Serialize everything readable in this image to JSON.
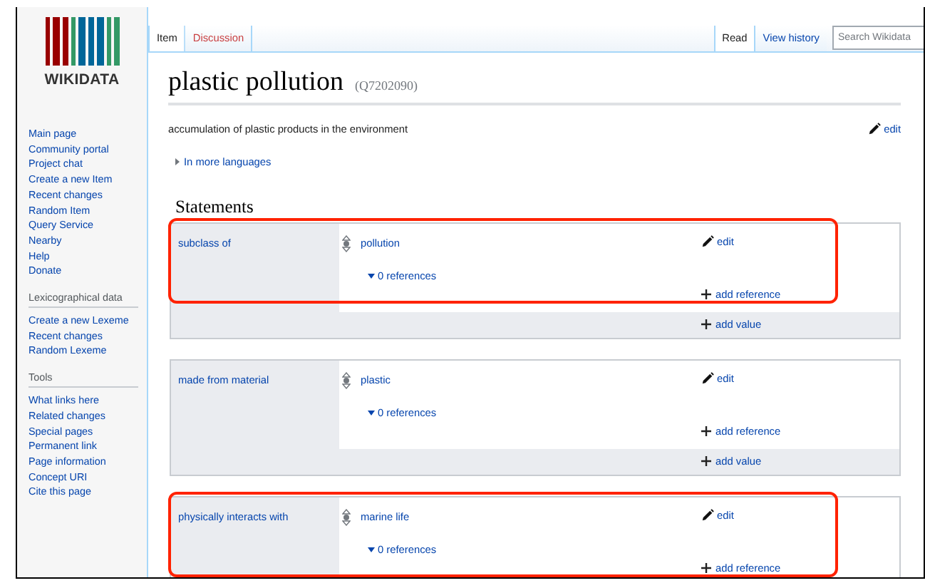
{
  "logo": {
    "wordmark": "WIKIDATA"
  },
  "sidebar": {
    "nav": [
      "Main page",
      "Community portal",
      "Project chat",
      "Create a new Item",
      "Recent changes",
      "Random Item",
      "Query Service",
      "Nearby",
      "Help",
      "Donate"
    ],
    "sections": [
      {
        "heading": "Lexicographical data",
        "items": [
          "Create a new Lexeme",
          "Recent changes",
          "Random Lexeme"
        ]
      },
      {
        "heading": "Tools",
        "items": [
          "What links here",
          "Related changes",
          "Special pages",
          "Permanent link",
          "Page information",
          "Concept URI",
          "Cite this page"
        ]
      }
    ]
  },
  "tabs_left": [
    {
      "label": "Item",
      "selected": true,
      "exists": true
    },
    {
      "label": "Discussion",
      "selected": false,
      "exists": false
    }
  ],
  "tabs_right": [
    {
      "label": "Read",
      "selected": true,
      "exists": true
    },
    {
      "label": "View history",
      "selected": false,
      "exists": true
    }
  ],
  "search": {
    "placeholder": "Search Wikidata"
  },
  "item": {
    "label": "plastic pollution",
    "id": "(Q7202090)",
    "description": "accumulation of plastic products in the environment",
    "edit": "edit",
    "more_languages": "In more languages"
  },
  "statements_heading": "Statements",
  "statements": [
    {
      "property": "subclass of",
      "value": "pollution",
      "edit": "edit",
      "references": "0 references",
      "add_reference": "add reference",
      "add_value": "add value",
      "highlighted": true
    },
    {
      "property": "made from material",
      "value": "plastic",
      "edit": "edit",
      "references": "0 references",
      "add_reference": "add reference",
      "add_value": "add value",
      "highlighted": false
    },
    {
      "property": "physically interacts with",
      "value": "marine life",
      "edit": "edit",
      "references": "0 references",
      "add_reference": "add reference",
      "highlighted": true
    }
  ]
}
